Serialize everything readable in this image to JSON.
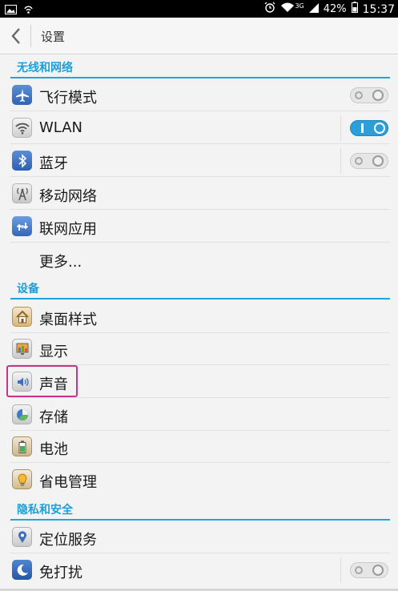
{
  "status_bar": {
    "network_type": "3G",
    "battery": "42%",
    "time": "15:37"
  },
  "header": {
    "title": "设置"
  },
  "sections": {
    "wireless": {
      "title": "无线和网络"
    },
    "device": {
      "title": "设备"
    },
    "privacy": {
      "title": "隐私和安全"
    }
  },
  "items": {
    "airplane": {
      "label": "飞行模式",
      "icon": "airplane-icon",
      "toggle": "off"
    },
    "wlan": {
      "label": "WLAN",
      "icon": "wifi-icon",
      "toggle": "on"
    },
    "bluetooth": {
      "label": "蓝牙",
      "icon": "bluetooth-icon",
      "toggle": "off"
    },
    "mobile": {
      "label": "移动网络",
      "icon": "antenna-icon"
    },
    "tether": {
      "label": "联网应用",
      "icon": "network-share-icon"
    },
    "more": {
      "label": "更多..."
    },
    "desktop": {
      "label": "桌面样式",
      "icon": "home-icon"
    },
    "display": {
      "label": "显示",
      "icon": "display-icon"
    },
    "sound": {
      "label": "声音",
      "icon": "speaker-icon",
      "highlighted": true
    },
    "storage": {
      "label": "存储",
      "icon": "pie-chart-icon"
    },
    "battery": {
      "label": "电池",
      "icon": "battery-icon"
    },
    "power": {
      "label": "省电管理",
      "icon": "lightbulb-icon"
    },
    "location": {
      "label": "定位服务",
      "icon": "location-pin-icon"
    },
    "dnd": {
      "label": "免打扰",
      "icon": "moon-icon",
      "toggle": "off"
    }
  },
  "colors": {
    "accent": "#1aa7df",
    "toggle_on": "#2c9fd8",
    "highlight": "#c9338b"
  }
}
